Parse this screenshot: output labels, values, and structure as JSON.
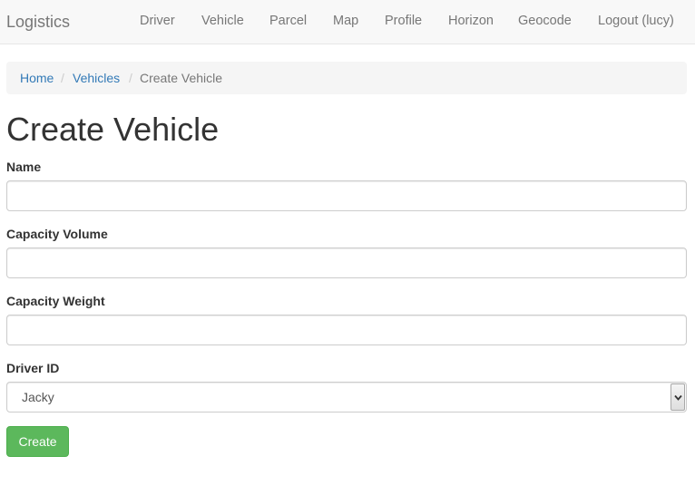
{
  "navbar": {
    "brand": "Logistics",
    "items": [
      {
        "label": "Driver"
      },
      {
        "label": "Vehicle"
      },
      {
        "label": "Parcel"
      },
      {
        "label": "Map"
      },
      {
        "label": "Profile"
      },
      {
        "label": "Horizon"
      },
      {
        "label": "Geocode"
      },
      {
        "label": "Logout (lucy)"
      }
    ]
  },
  "breadcrumb": {
    "items": [
      {
        "label": "Home"
      },
      {
        "label": "Vehicles"
      },
      {
        "label": "Create Vehicle"
      }
    ],
    "separator": "/"
  },
  "page": {
    "title": "Create Vehicle"
  },
  "form": {
    "fields": [
      {
        "label": "Name",
        "value": ""
      },
      {
        "label": "Capacity Volume",
        "value": ""
      },
      {
        "label": "Capacity Weight",
        "value": ""
      }
    ],
    "driver": {
      "label": "Driver ID",
      "selected": "Jacky"
    },
    "submit_label": "Create"
  },
  "colors": {
    "link": "#337ab7",
    "success": "#5cb85c",
    "navbar_bg": "#f8f8f8",
    "breadcrumb_bg": "#f5f5f5"
  }
}
